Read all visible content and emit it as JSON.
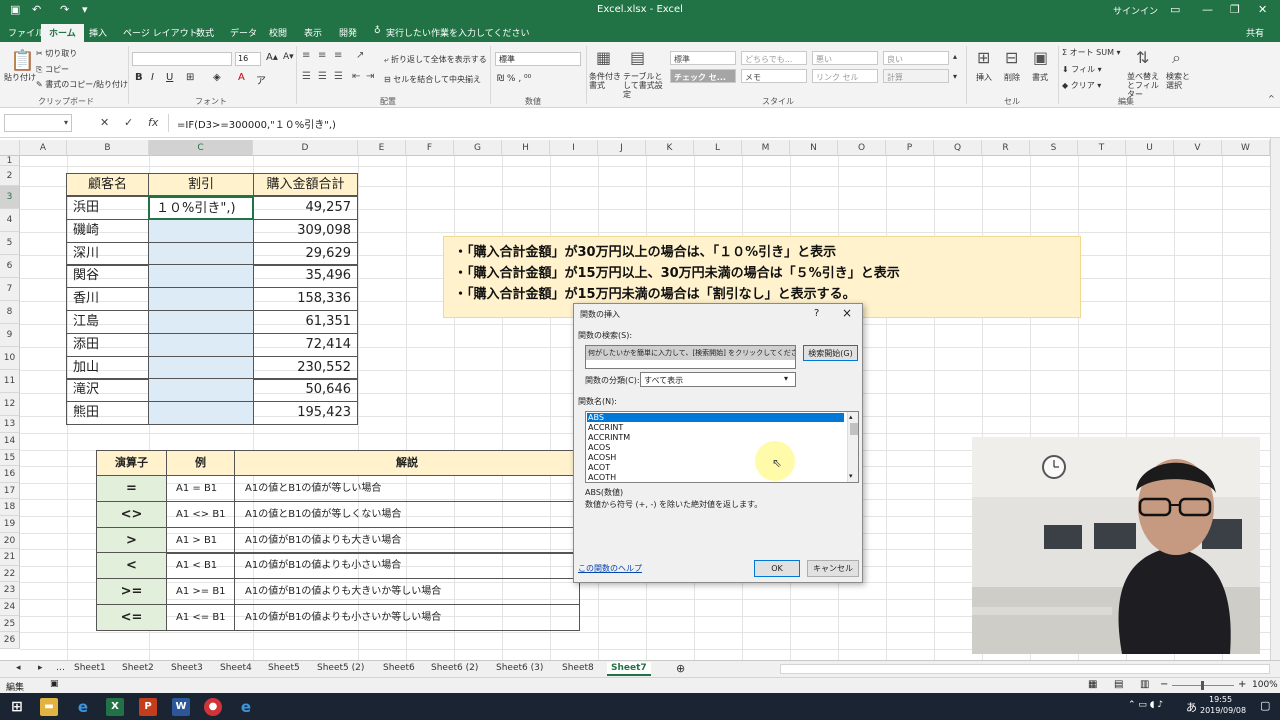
{
  "window": {
    "title": "Excel.xlsx  -  Excel",
    "signin": "サインイン"
  },
  "tabs": [
    "ファイル",
    "ホーム",
    "挿入",
    "ページ レイアウト",
    "数式",
    "データ",
    "校閲",
    "表示",
    "開発"
  ],
  "tell_me": "実行したい作業を入力してください",
  "share": "共有",
  "ribbon": {
    "paste": "貼り付け",
    "cut": "切り取り",
    "copy": "コピー",
    "format_painter": "書式のコピー/貼り付け",
    "clipboard": "クリップボード",
    "font_size": "16",
    "font": "フォント",
    "wrap_text": "折り返して全体を表示する",
    "merge_center": "セルを結合して中央揃え",
    "alignment": "配置",
    "number_format": "標準",
    "number": "数値",
    "conditional": "条件付き書式",
    "as_table": "テーブルとして書式設定",
    "styles": [
      "標準",
      "どちらでも...",
      "悪い",
      "良い",
      "チェック セ...",
      "メモ",
      "リンク セル",
      "計算"
    ],
    "style_group": "スタイル",
    "insert": "挿入",
    "delete": "削除",
    "format": "書式",
    "cells": "セル",
    "autosum": "オート SUM",
    "fill": "フィル",
    "clear": "クリア",
    "sort_filter": "並べ替えとフィルター",
    "find_select": "検索と選択",
    "editing": "編集"
  },
  "formula_bar": {
    "name_box": "",
    "formula": "=IF(D3>=300000,\"１０%引き\",)"
  },
  "columns": [
    "A",
    "B",
    "C",
    "D",
    "E",
    "F",
    "G",
    "H",
    "I",
    "J",
    "K",
    "L",
    "M",
    "N",
    "O",
    "P",
    "Q",
    "R",
    "S",
    "T",
    "U",
    "V",
    "W"
  ],
  "rows": [
    "1",
    "2",
    "3",
    "4",
    "5",
    "6",
    "7",
    "8",
    "9",
    "10",
    "11",
    "12",
    "13",
    "14",
    "15",
    "16",
    "17",
    "18",
    "19",
    "20",
    "21",
    "22",
    "23",
    "24",
    "25",
    "26"
  ],
  "customer_table": {
    "headers": [
      "顧客名",
      "割引",
      "購入金額合計"
    ],
    "editing_cell": "１０%引き\",)",
    "rows": [
      {
        "name": "浜田",
        "amount": "49,257"
      },
      {
        "name": "磯崎",
        "amount": "309,098"
      },
      {
        "name": "深川",
        "amount": "29,629"
      },
      {
        "name": "関谷",
        "amount": "35,496"
      },
      {
        "name": "香川",
        "amount": "158,336"
      },
      {
        "name": "江島",
        "amount": "61,351"
      },
      {
        "name": "添田",
        "amount": "72,414"
      },
      {
        "name": "加山",
        "amount": "230,552"
      },
      {
        "name": "滝沢",
        "amount": "50,646"
      },
      {
        "name": "熊田",
        "amount": "195,423"
      }
    ]
  },
  "note": [
    "・「購入合計金額」が30万円以上の場合は、「１０%引き」と表示",
    "・「購入合計金額」が15万円以上、30万円未満の場合は「５%引き」と表示",
    "・「購入合計金額」が15万円未満の場合は「割引なし」と表示する。"
  ],
  "operator_table": {
    "headers": [
      "演算子",
      "例",
      "解説"
    ],
    "rows": [
      {
        "op": "=",
        "example": "A1 = B1",
        "desc": "A1の値とB1の値が等しい場合"
      },
      {
        "op": "<>",
        "example": "A1 <> B1",
        "desc": "A1の値とB1の値が等しくない場合"
      },
      {
        "op": ">",
        "example": "A1 > B1",
        "desc": "A1の値がB1の値よりも大きい場合"
      },
      {
        "op": "<",
        "example": "A1 < B1",
        "desc": "A1の値がB1の値よりも小さい場合"
      },
      {
        "op": ">=",
        "example": "A1 >= B1",
        "desc": "A1の値がB1の値よりも大きいか等しい場合"
      },
      {
        "op": "<=",
        "example": "A1 <= B1",
        "desc": "A1の値がB1の値よりも小さいか等しい場合"
      }
    ]
  },
  "dialog": {
    "title": "関数の挿入",
    "help": "?",
    "close": "×",
    "search_label": "関数の検索(S):",
    "search_placeholder": "何がしたいかを簡単に入力して、[検索開始] をクリックしてください。",
    "search_button": "検索開始(G)",
    "category_label": "関数の分類(C):",
    "category_value": "すべて表示",
    "fn_label": "関数名(N):",
    "functions": [
      "ABS",
      "ACCRINT",
      "ACCRINTM",
      "ACOS",
      "ACOSH",
      "ACOT",
      "ACOTH"
    ],
    "signature": "ABS(数値)",
    "description": "数値から符号 (+, -) を除いた絶対値を返します。",
    "help_link": "この関数のヘルプ",
    "ok": "OK",
    "cancel": "キャンセル"
  },
  "sheets": [
    "Sheet1",
    "Sheet2",
    "Sheet3",
    "Sheet4",
    "Sheet5",
    "Sheet5 (2)",
    "Sheet6",
    "Sheet6 (2)",
    "Sheet6 (3)",
    "Sheet8",
    "Sheet7"
  ],
  "status": {
    "mode": "編集",
    "zoom": "100%"
  },
  "taskbar": {
    "ime": "あ",
    "time": "19:55",
    "date": "2019/09/08"
  },
  "colors": {
    "excel_green": "#217346",
    "header_yellow": "#fff2cc",
    "selection_blue": "#ddebf7",
    "operator_green": "#e2efda"
  }
}
